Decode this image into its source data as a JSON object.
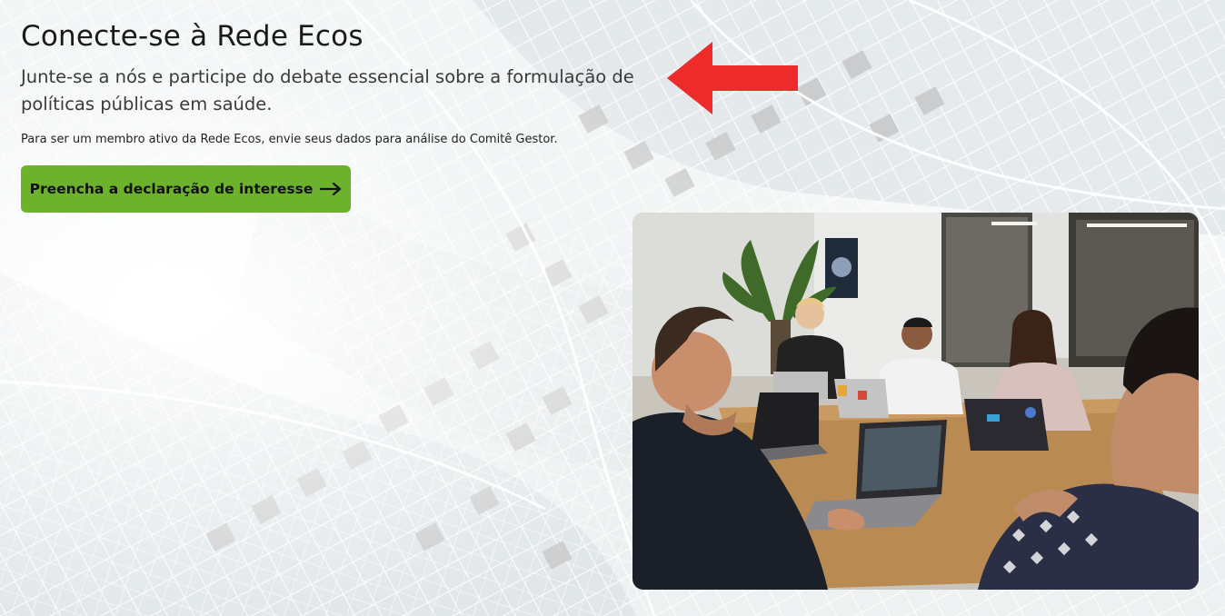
{
  "hero": {
    "title": "Conecte-se à Rede Ecos",
    "subtitle": "Junte-se a nós e participe do debate essencial sobre a formulação de políticas públicas em saúde.",
    "note": "Para ser um membro ativo da Rede Ecos, envie seus dados para análise do Comitê Gestor.",
    "cta_label": "Preencha a declaração de interesse",
    "cta_icon": "arrow-right-icon"
  },
  "annotation": {
    "icon": "red-arrow-left-icon",
    "color": "#ee2b2b"
  },
  "colors": {
    "cta_background": "#6db22c",
    "title_text": "#1a1a1a"
  },
  "photo": {
    "subject": "team-meeting-photo"
  }
}
